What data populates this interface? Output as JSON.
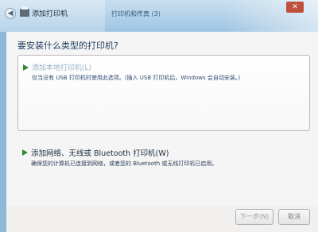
{
  "background_window": {
    "title_text": "打印机和传真 (3)",
    "close_glyph": "✕"
  },
  "dialog": {
    "title": "添加打印机",
    "back_glyph": "◀",
    "question": "要安装什么类型的打印机?",
    "options": [
      {
        "title": "添加本地打印机(L)",
        "description": "仅当没有 USB 打印机时使用此选项。(插入 USB 打印机后，Windows 会自动安装。)"
      },
      {
        "title": "添加网络、无线或 Bluetooth 打印机(W)",
        "description": "确保您的计算机已连接到网络，或者您的 Bluetooth 或无线打印机已启用。"
      }
    ],
    "buttons": {
      "next_label": "下一步(N)",
      "cancel_label": "取消"
    }
  }
}
